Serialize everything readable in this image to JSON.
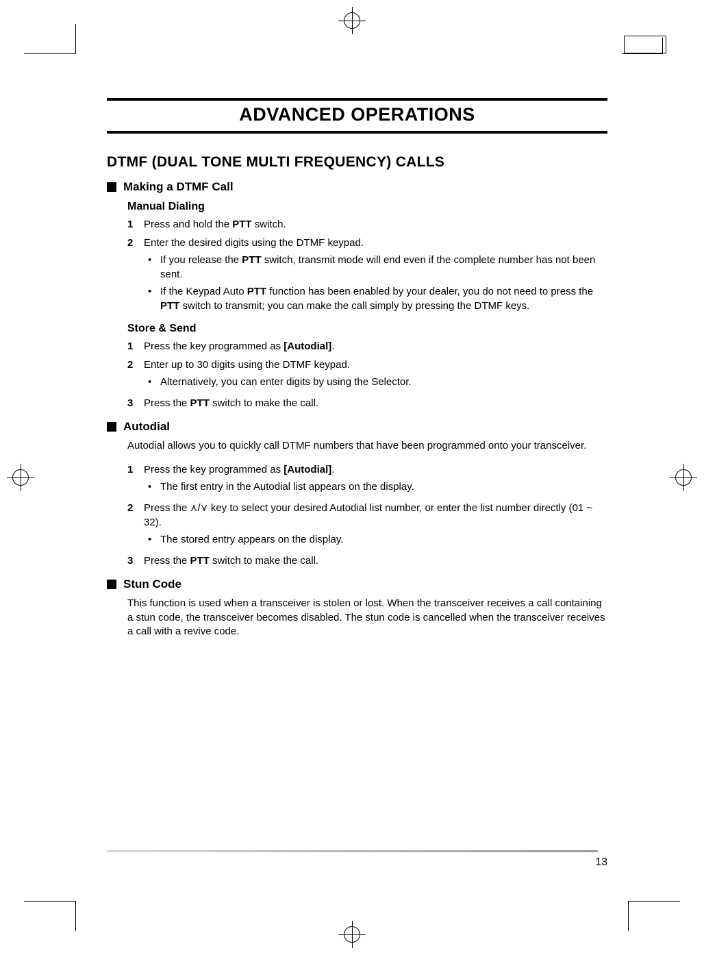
{
  "chapter_title": "ADVANCED OPERATIONS",
  "section_title": "DTMF (DUAL TONE MULTI FREQUENCY) CALLS",
  "sub1": {
    "title": "Making a DTMF Call",
    "manual": {
      "heading": "Manual Dialing",
      "step1_pre": "Press and hold the ",
      "step1_b": "PTT",
      "step1_post": " switch.",
      "step2": "Enter the desired digits using the DTMF keypad.",
      "b1_pre": "If you release the ",
      "b1_b": "PTT",
      "b1_post": " switch, transmit mode will end even if the complete number has not been sent.",
      "b2_pre": "If the Keypad Auto ",
      "b2_b1": "PTT",
      "b2_mid": " function has been enabled by your dealer, you do not need to press the ",
      "b2_b2": "PTT",
      "b2_post": " switch to transmit; you can make the call simply by pressing the DTMF keys."
    },
    "store": {
      "heading": "Store & Send",
      "step1_pre": "Press the key programmed as ",
      "step1_b": "[Autodial]",
      "step1_post": ".",
      "step2": "Enter up to 30 digits using the DTMF keypad.",
      "b1": "Alternatively, you can enter digits by using the Selector.",
      "step3_pre": "Press the ",
      "step3_b": "PTT",
      "step3_post": " switch to make the call."
    }
  },
  "sub2": {
    "title": "Autodial",
    "intro": "Autodial allows you to quickly call DTMF numbers that have been programmed onto your transceiver.",
    "step1_pre": "Press the key programmed as ",
    "step1_b": "[Autodial]",
    "step1_post": ".",
    "b1": "The first entry in the Autodial list appears on the display.",
    "step2_pre": "Press the ",
    "step2_arrows": "⋏/⋎",
    "step2_post": " key to select your desired Autodial list number, or enter the list number directly (01 ~ 32).",
    "b2": "The stored entry appears on the display.",
    "step3_pre": "Press the ",
    "step3_b": "PTT",
    "step3_post": " switch to make the call."
  },
  "sub3": {
    "title": "Stun Code",
    "body": "This function is used when a transceiver is stolen or lost.  When the transceiver receives a call containing a stun code, the transceiver becomes disabled.  The stun code is cancelled when the transceiver receives a call with a revive code."
  },
  "page_number": "13"
}
